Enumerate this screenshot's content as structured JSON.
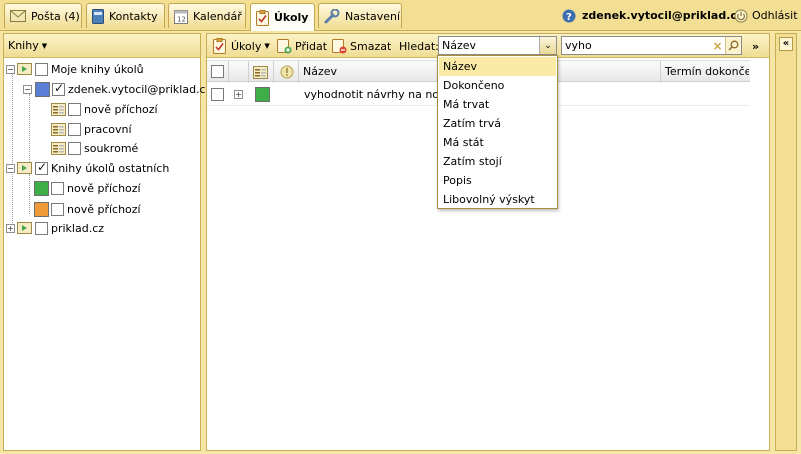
{
  "tabs": [
    {
      "label": "Pošta (4)",
      "icon": "mail-icon"
    },
    {
      "label": "Kontakty",
      "icon": "contacts-book-icon"
    },
    {
      "label": "Kalendář",
      "icon": "calendar-icon"
    },
    {
      "label": "Úkoly",
      "icon": "tasks-clipboard-icon",
      "active": true
    },
    {
      "label": "Nastavení",
      "icon": "wrench-icon"
    }
  ],
  "user": {
    "email": "zdenek.vytocil@priklad.cz",
    "logout_label": "Odhlásit"
  },
  "left_panel": {
    "header": "Knihy",
    "tree": [
      {
        "label": "Moje knihy úkolů",
        "checked": false
      },
      {
        "label": "zdenek.vytocil@priklad.cz",
        "checked": true,
        "color": "#5b7fd6"
      },
      {
        "label": "nově příchozí",
        "checked": false
      },
      {
        "label": "pracovní",
        "checked": false
      },
      {
        "label": "soukromé",
        "checked": false
      },
      {
        "label": "Knihy úkolů ostatních",
        "checked": true
      },
      {
        "label": "nově příchozí",
        "checked": false,
        "color": "#3fae49"
      },
      {
        "label": "nově příchozí",
        "checked": false,
        "color": "#ef9b3a"
      },
      {
        "label": "priklad.cz",
        "checked": false
      }
    ]
  },
  "toolbar": {
    "tasks_menu": "Úkoly",
    "add": "Přidat",
    "delete": "Smazat",
    "search_label": "Hledat:",
    "search_field_value": "Název",
    "search_value": "vyho",
    "more": "»"
  },
  "grid": {
    "columns": {
      "name": "Název",
      "due": "Termín dokončen"
    },
    "rows": [
      {
        "name": "vyhodnotit návrhy na nový l",
        "color": "#3fae49"
      }
    ]
  },
  "dropdown": {
    "options": [
      "Název",
      "Dokončeno",
      "Má trvat",
      "Zatím trvá",
      "Má stát",
      "Zatím stojí",
      "Popis",
      "Libovolný výskyt"
    ],
    "selected_index": 0
  },
  "right_panel": {
    "collapse": "«"
  }
}
